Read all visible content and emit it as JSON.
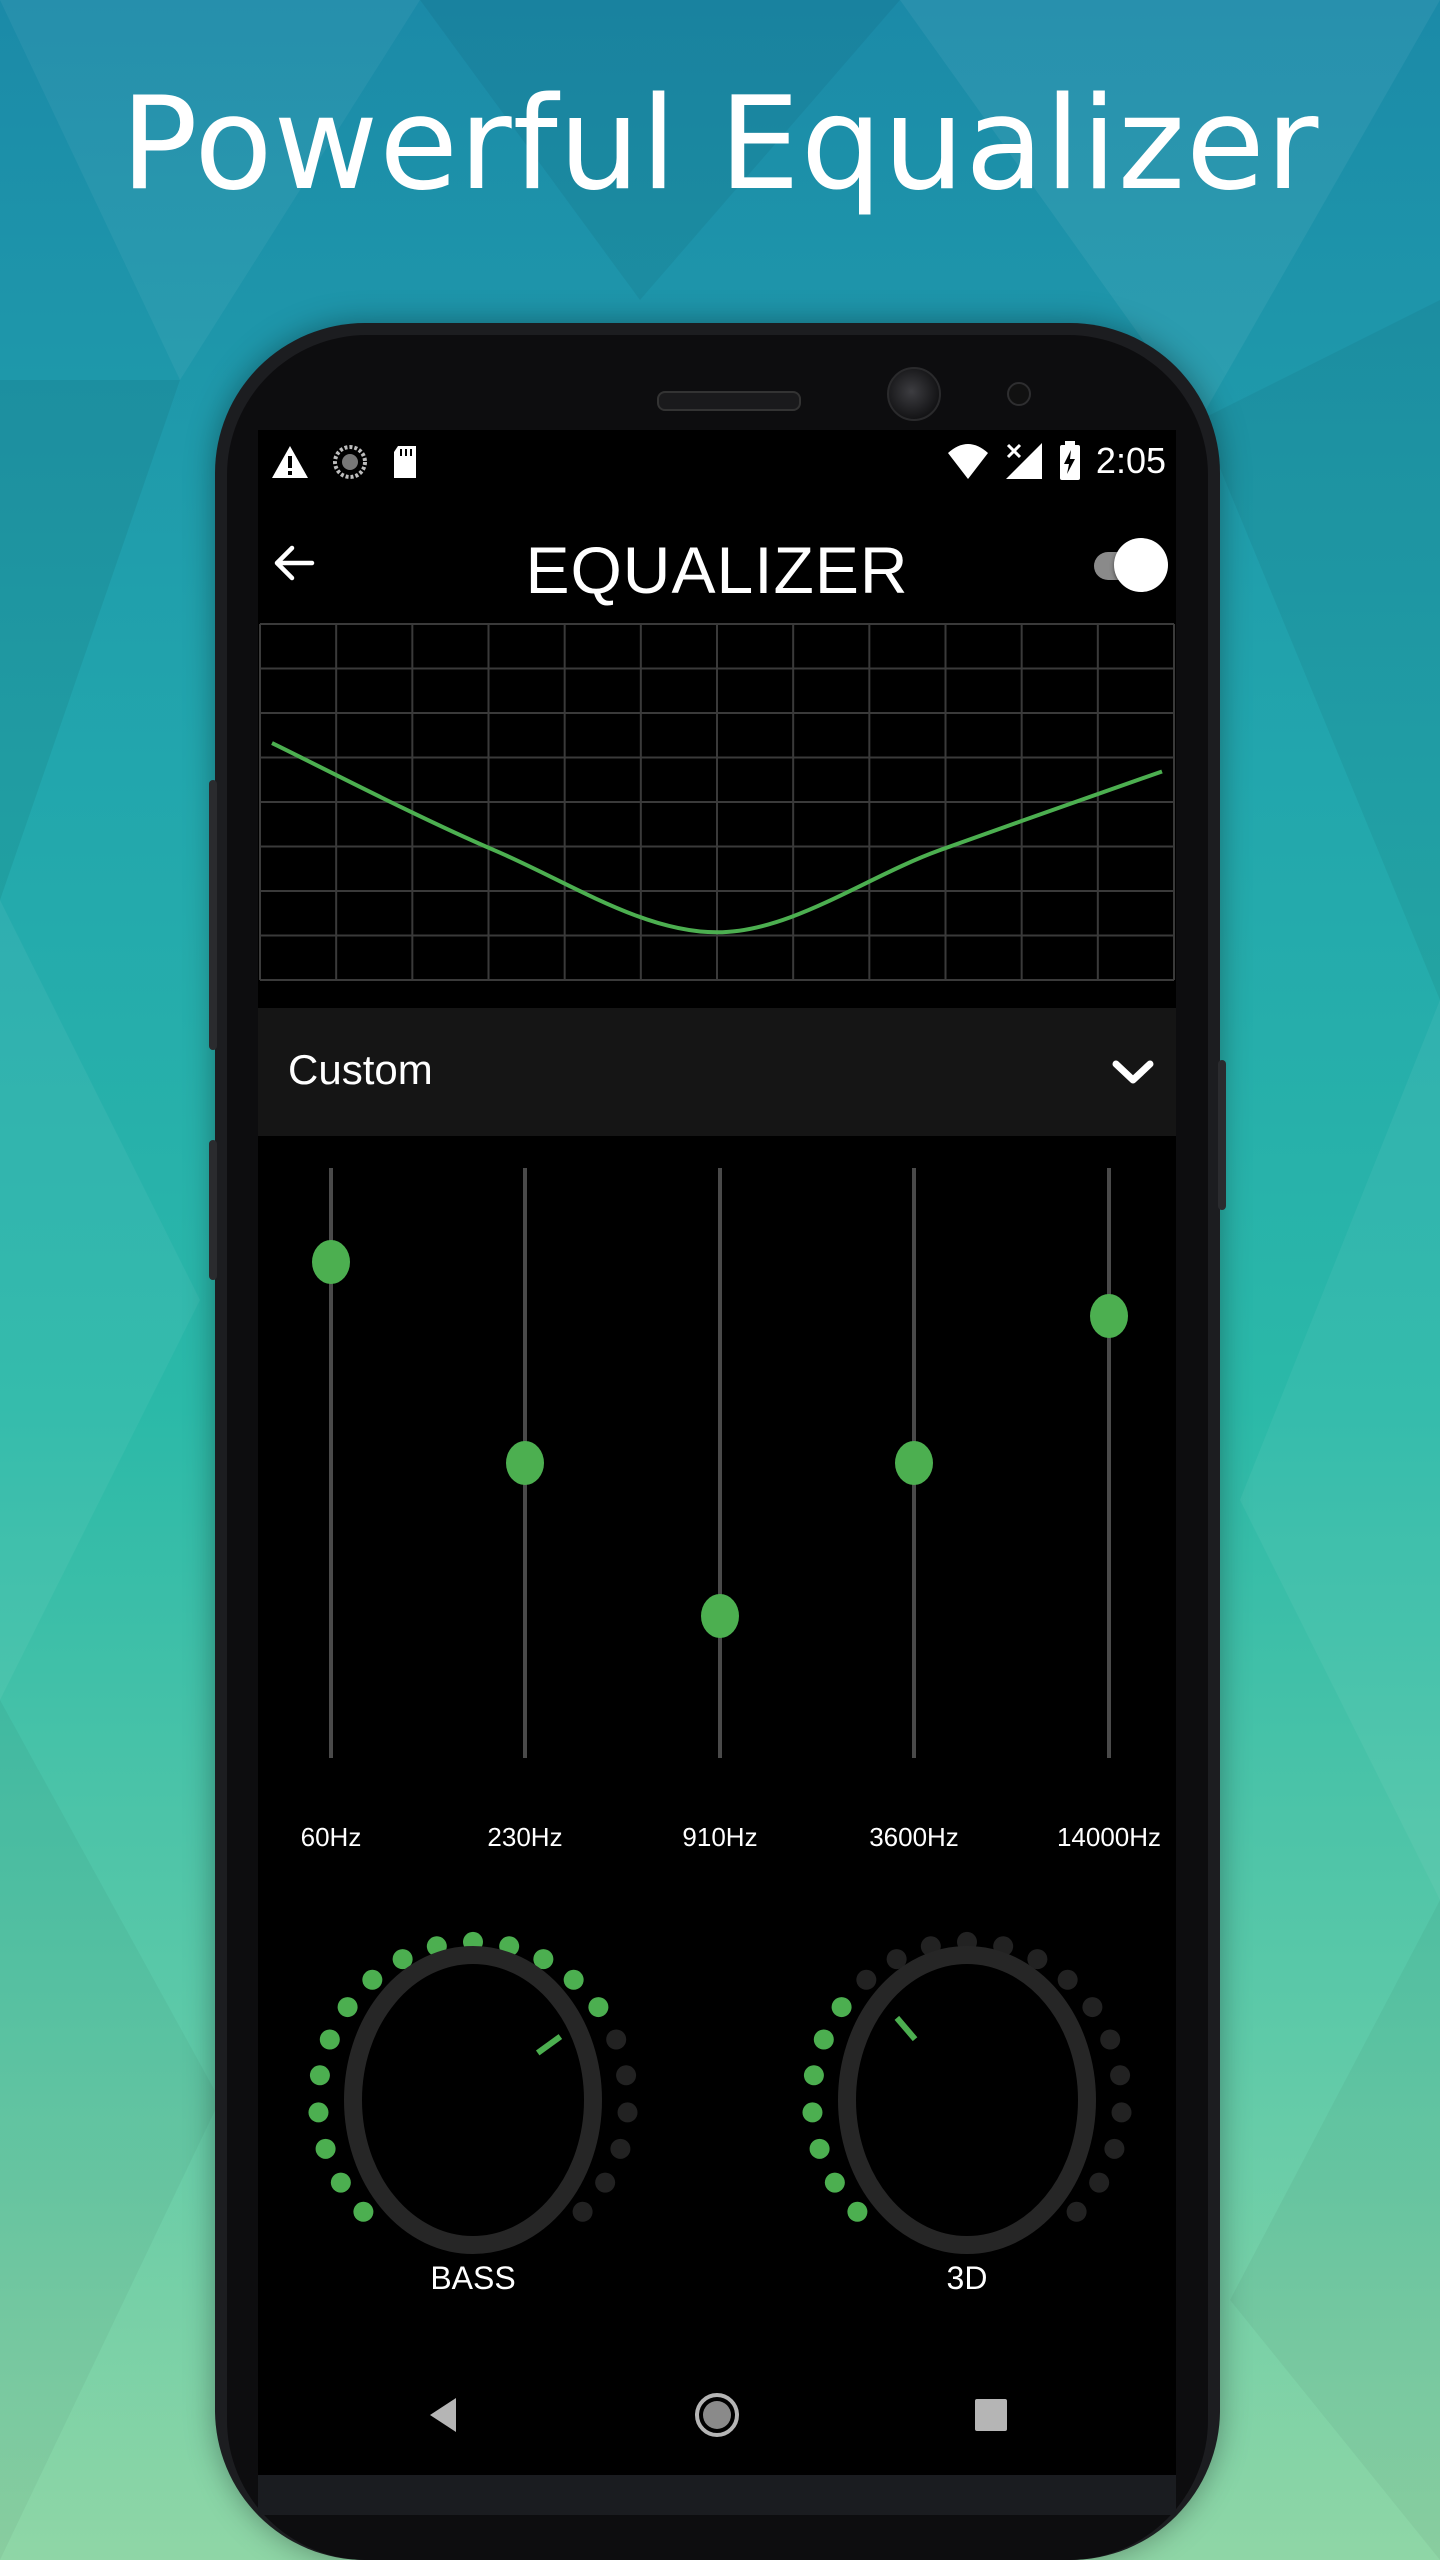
{
  "headline": "Powerful Equalizer",
  "status_bar": {
    "time": "2:05",
    "left_icons": [
      "warning-icon",
      "sync-icon",
      "sd-card-icon"
    ],
    "right_icons": [
      "wifi-icon",
      "signal-off-icon",
      "battery-charging-icon"
    ]
  },
  "app_bar": {
    "title": "EQUALIZER",
    "back_icon": "arrow-back-icon",
    "enabled": true
  },
  "preset": {
    "label": "Custom",
    "icon": "chevron-down-icon"
  },
  "bands": [
    {
      "label": "60Hz",
      "level": 0.84
    },
    {
      "label": "230Hz",
      "level": 0.5
    },
    {
      "label": "910Hz",
      "level": 0.24
    },
    {
      "label": "3600Hz",
      "level": 0.5
    },
    {
      "label": "14000Hz",
      "level": 0.75
    }
  ],
  "knobs": [
    {
      "label": "BASS",
      "level": 0.7
    },
    {
      "label": "3D",
      "level": 0.35
    }
  ],
  "colors": {
    "accent": "#4caf50",
    "screen_bg": "#000000",
    "grid": "#3a3a3a",
    "dot_inactive": "#222222"
  },
  "nav_bar": [
    "nav-back-icon",
    "nav-home-icon",
    "nav-recents-icon"
  ]
}
